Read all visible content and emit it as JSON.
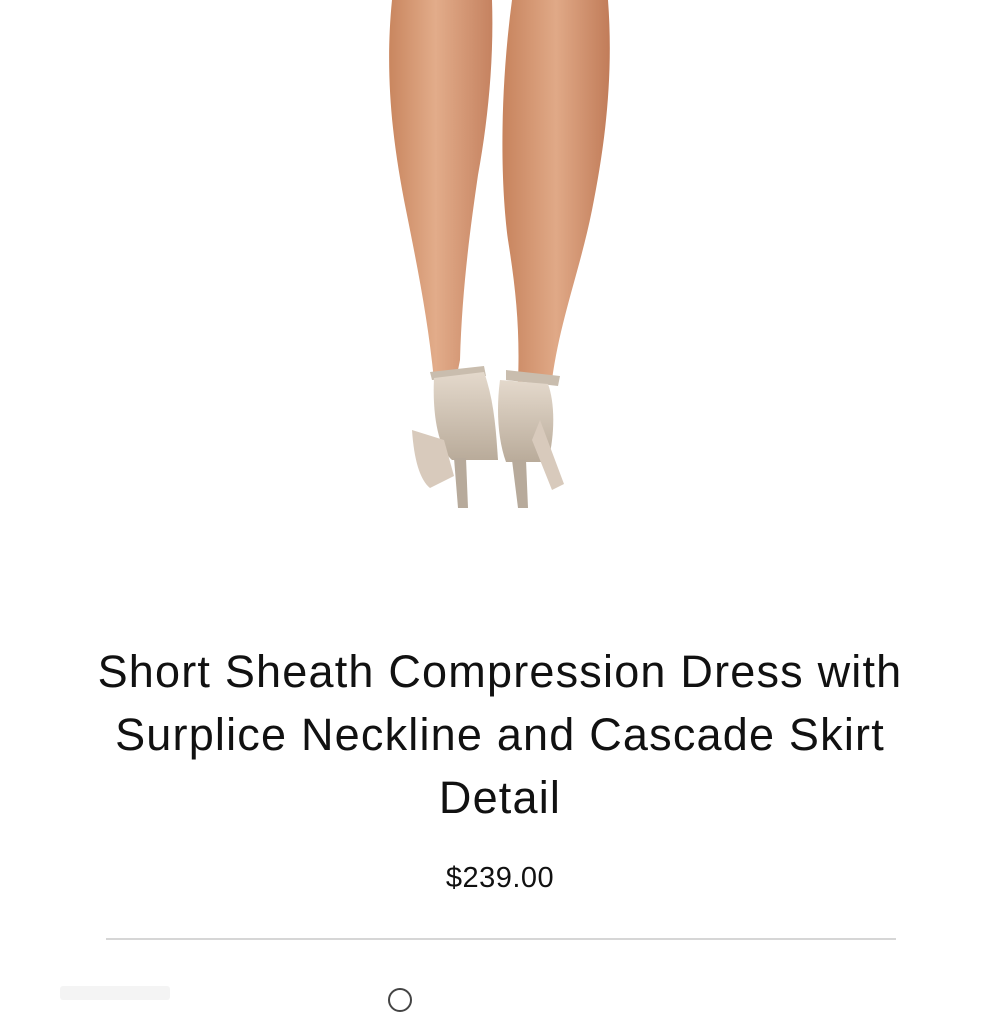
{
  "product": {
    "title": "Short Sheath Compression Dress with Surplice Neckline and Cascade Skirt Detail",
    "price": "$239.00"
  },
  "colors": {
    "skin": "#d79b78",
    "shoe": "#cdbfae",
    "divider": "#d6d6d6",
    "text": "#111111"
  }
}
